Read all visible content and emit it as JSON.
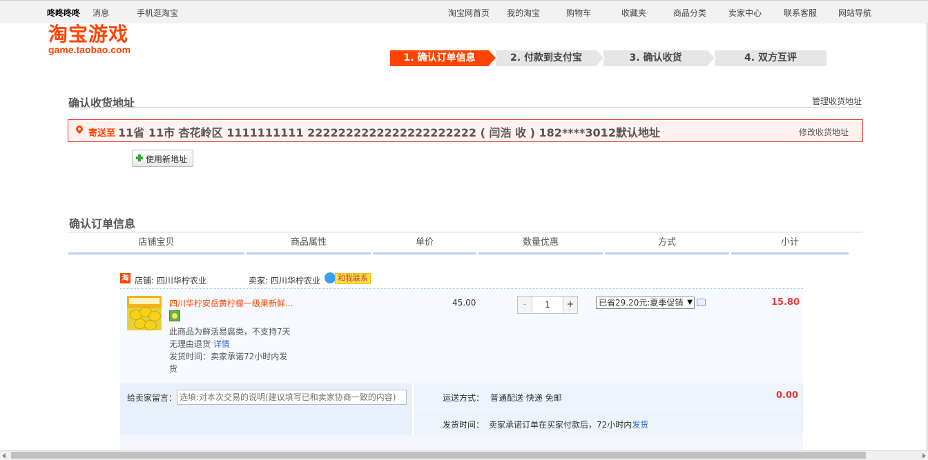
{
  "topbar": {
    "user": "咚咚咚咚",
    "messages": "消息",
    "mobile": "手机逛淘宝",
    "nav": [
      "淘宝网首页",
      "我的淘宝",
      "购物车",
      "收藏夹",
      "商品分类",
      "卖家中心",
      "联系客服",
      "网站导航"
    ]
  },
  "logo": {
    "main": "淘宝游戏",
    "sub": "game.taobao.com"
  },
  "steps": [
    "1. 确认订单信息",
    "2. 付款到支付宝",
    "3. 确认收货",
    "4. 双方互评"
  ],
  "address": {
    "section_title": "确认收货地址",
    "manage_link": "管理收货地址",
    "label": "寄送至",
    "text": "11省 11市 杏花岭区 1111111111 2222222222222222222222 ( 闫浩 收 ) 182****3012默认地址",
    "edit_link": "修改收货地址",
    "new_button": "使用新地址"
  },
  "order": {
    "section_title": "确认订单信息",
    "columns": [
      "店铺宝贝",
      "商品属性",
      "单价",
      "数量优惠",
      "方式",
      "小计"
    ],
    "shop_icon": "淘",
    "shop": "店铺: 四川华柠农业",
    "seller": "卖家: 四川华柠农业",
    "contact": "和我联系",
    "item": {
      "title": "四川华柠安岳黄柠檬一级果新鲜...",
      "note": "此商品为鲜活易腐类，不支持7天无理由退货",
      "detail_link": "详情",
      "ship_time": "发货时间：卖家承诺72小时内发货",
      "price": "45.00",
      "quantity": "1",
      "minus": "-",
      "plus": "+",
      "promo": "已省29.20元:夏季促销",
      "subtotal": "15.80"
    },
    "message_label": "给卖家留言：",
    "message_placeholder": "选填:对本次交易的说明(建议填写已和卖家协商一致的内容)",
    "shipping_label": "运送方式：",
    "shipping_value": "普通配送 快递 免邮",
    "shipping_fee": "0.00",
    "time_label": "发货时间：",
    "time_value": "卖家承诺订单在买家付款后，72小时内",
    "time_link": "发货"
  },
  "colors": {
    "accent": "#ff4400",
    "price_red": "#e4393c",
    "link_blue": "#3366cc"
  },
  "icons": [
    "location-pin-icon",
    "plus-icon",
    "shop-icon",
    "wangwang-icon",
    "chat-icon",
    "dropdown-caret-icon"
  ]
}
